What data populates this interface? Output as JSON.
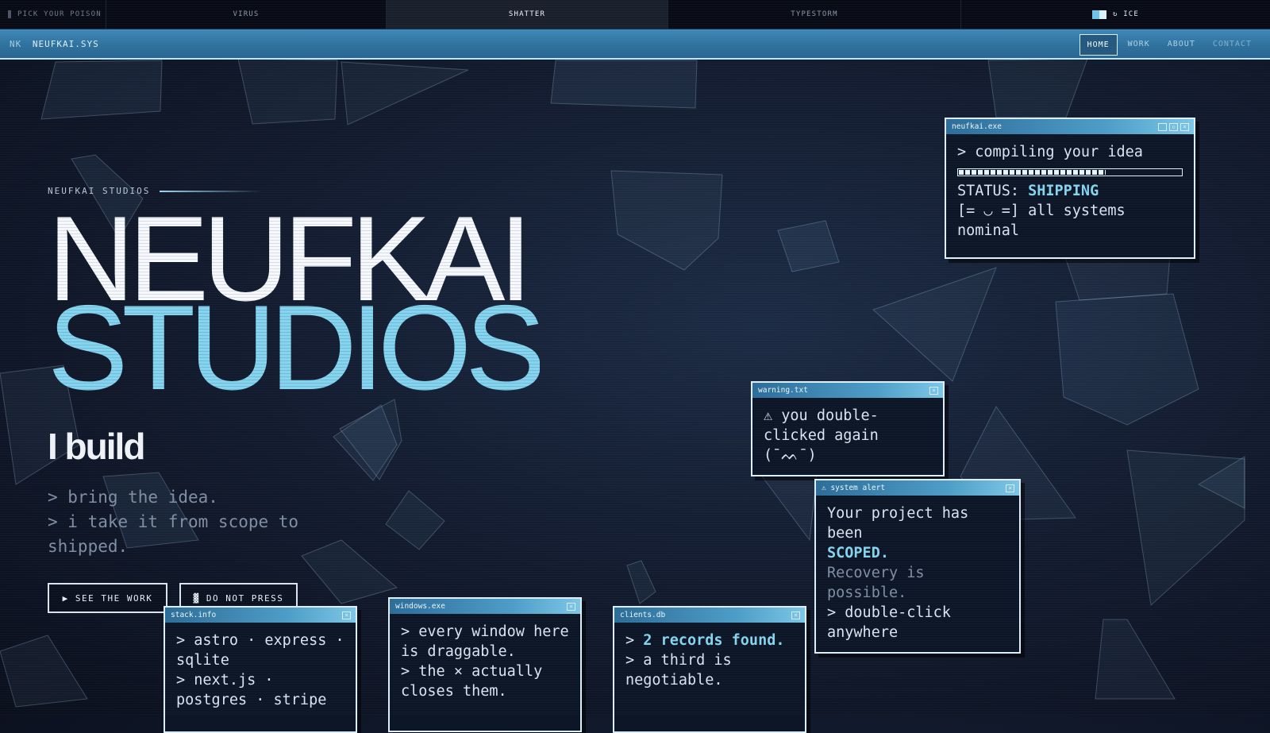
{
  "theme_bar": {
    "pick_label": "PICK YOUR POISON",
    "themes": [
      "VIRUS",
      "SHATTER",
      "TYPESTORM"
    ],
    "active_theme": "SHATTER",
    "ice_label": "↻ ICE"
  },
  "nav": {
    "logo": "NK",
    "brand": "NEUFKAI.SYS",
    "links": [
      "HOME",
      "WORK",
      "ABOUT",
      "CONTACT"
    ],
    "active": "HOME"
  },
  "hero": {
    "eyebrow": "NEUFKAI STUDIOS",
    "title_line1": "NEUFKAI",
    "title_line2": "STUDIOS",
    "subtitle": "I build",
    "tagline": [
      "> bring the idea.",
      "> i take it from scope to shipped."
    ],
    "primary_button": "▶ SEE THE WORK",
    "secondary_button": "▓ DO NOT PRESS"
  },
  "windows": {
    "neufkai": {
      "title": "neufkai.exe",
      "line1": "> compiling your idea",
      "progress": 0.66,
      "status_label": "STATUS:",
      "status_value": "SHIPPING",
      "line3": "[= ◡ =] all systems nominal"
    },
    "warning": {
      "title": "warning.txt",
      "text": "⚠ you double-clicked again (¯ᨓ¯)"
    },
    "alert": {
      "title": "⚠ system alert",
      "line1": "Your project has been",
      "line2": "SCOPED.",
      "line3": "Recovery is possible.",
      "line4": "> double-click anywhere"
    },
    "stack": {
      "title": "stack.info",
      "line1": "> astro · express · sqlite",
      "line2": "> next.js · postgres · stripe"
    },
    "windows_exe": {
      "title": "windows.exe",
      "line1": "> every window here is draggable.",
      "line2": "> the × actually closes them."
    },
    "clients": {
      "title": "clients.db",
      "line1": "2 records found.",
      "line2": "> a third is negotiable."
    }
  },
  "colors": {
    "accent": "#86d3ee",
    "navbar": "#3d88b9",
    "background": "#131c30"
  }
}
